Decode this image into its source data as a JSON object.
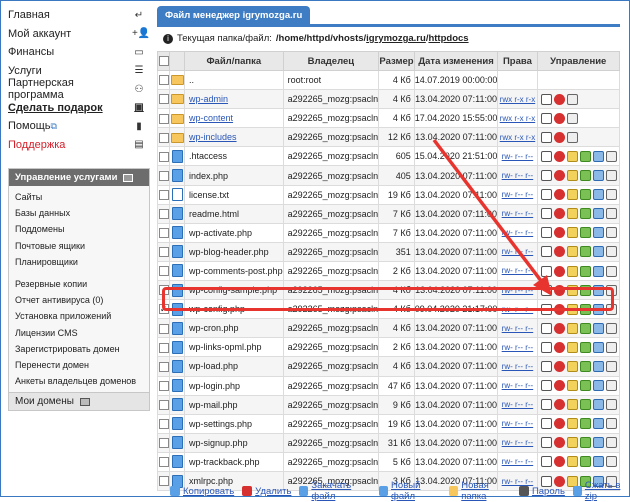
{
  "sidebar": {
    "items": [
      {
        "label": "Главная",
        "icon": "back-arrow-icon",
        "style": ""
      },
      {
        "label": "Мой аккаунт",
        "icon": "user-add-icon",
        "style": ""
      },
      {
        "label": "Финансы",
        "icon": "money-icon",
        "style": ""
      },
      {
        "label": "Услуги",
        "icon": "list-icon",
        "style": ""
      },
      {
        "label": "Партнерская программа",
        "icon": "partners-icon",
        "style": ""
      },
      {
        "label": "Сделать подарок",
        "icon": "gift-icon",
        "style": "bold"
      },
      {
        "label": "Помощь",
        "icon": "help-icon",
        "style": "",
        "ext": "⧉"
      },
      {
        "label": "Поддержка",
        "icon": "support-icon",
        "style": "red"
      }
    ],
    "services": {
      "title": "Управление услугами",
      "items": [
        "Сайты",
        "Базы данных",
        "Поддомены",
        "Почтовые ящики",
        "Планировщики"
      ],
      "items2": [
        "Резервные копии",
        "Отчет антивируса (0)",
        "Установка приложений",
        "Лицензии CMS",
        "Зарегистрировать домен",
        "Перенести домен",
        "Анкеты владельцев доменов"
      ],
      "footer": "Мои домены"
    }
  },
  "main": {
    "tab": "Файл менеджер igrymozga.ru",
    "path_label": "Текущая папка/файл:",
    "path_prefix": "/home/httpd/vhosts/",
    "path_domain": "igrymozga.ru",
    "path_sep": "/",
    "path_last": "httpdocs",
    "columns": [
      "Файл/папка",
      "Владелец",
      "Размер",
      "Дата изменения",
      "Права",
      "Управление"
    ]
  },
  "files": [
    {
      "name": "..",
      "owner": "root:root",
      "size": "4 Кб",
      "date": "14.07.2019 00:00:00",
      "perms": "",
      "type": "up",
      "link": false,
      "checked": false
    },
    {
      "name": "wp-admin",
      "owner": "a292265_mozg:psacln",
      "size": "4 Кб",
      "date": "13.04.2020 07:11:00",
      "perms": "rwx r-x r-x",
      "type": "folder",
      "link": true,
      "checked": false
    },
    {
      "name": "wp-content",
      "owner": "a292265_mozg:psacln",
      "size": "4 Кб",
      "date": "17.04.2020 15:55:00",
      "perms": "rwx r-x r-x",
      "type": "folder",
      "link": true,
      "checked": false
    },
    {
      "name": "wp-includes",
      "owner": "a292265_mozg:psacln",
      "size": "12 Кб",
      "date": "13.04.2020 07:11:00",
      "perms": "rwx r-x r-x",
      "type": "folder",
      "link": true,
      "checked": false
    },
    {
      "name": ".htaccess",
      "owner": "a292265_mozg:psacln",
      "size": "605",
      "date": "15.04.2020 21:51:00",
      "perms": "rw- r-- r--",
      "type": "file",
      "link": false,
      "checked": false
    },
    {
      "name": "index.php",
      "owner": "a292265_mozg:psacln",
      "size": "405",
      "date": "13.04.2020 07:11:00",
      "perms": "rw- r-- r--",
      "type": "file",
      "link": false,
      "checked": false
    },
    {
      "name": "license.txt",
      "owner": "a292265_mozg:psacln",
      "size": "19 Кб",
      "date": "13.04.2020 07:11:00",
      "perms": "rw- r-- r--",
      "type": "txt",
      "link": false,
      "checked": false
    },
    {
      "name": "readme.html",
      "owner": "a292265_mozg:psacln",
      "size": "7 Кб",
      "date": "13.04.2020 07:11:00",
      "perms": "rw- r-- r--",
      "type": "file",
      "link": false,
      "checked": false
    },
    {
      "name": "wp-activate.php",
      "owner": "a292265_mozg:psacln",
      "size": "7 Кб",
      "date": "13.04.2020 07:11:00",
      "perms": "rw- r-- r--",
      "type": "file",
      "link": false,
      "checked": false
    },
    {
      "name": "wp-blog-header.php",
      "owner": "a292265_mozg:psacln",
      "size": "351",
      "date": "13.04.2020 07:11:00",
      "perms": "rw- r-- r--",
      "type": "file",
      "link": false,
      "checked": false
    },
    {
      "name": "wp-comments-post.php",
      "owner": "a292265_mozg:psacln",
      "size": "2 Кб",
      "date": "13.04.2020 07:11:00",
      "perms": "rw- r-- r--",
      "type": "file",
      "link": false,
      "checked": false
    },
    {
      "name": "wp-config-sample.php",
      "owner": "a292265_mozg:psacln",
      "size": "4 Кб",
      "date": "13.04.2020 07:11:00",
      "perms": "rw- r-- r--",
      "type": "file",
      "link": false,
      "checked": false
    },
    {
      "name": "wp-config.php",
      "owner": "a292265_mozg:psacln",
      "size": "4 Кб",
      "date": "09.04.2020 21:17:00",
      "perms": "rw- r-- r--",
      "type": "file",
      "link": false,
      "checked": true
    },
    {
      "name": "wp-cron.php",
      "owner": "a292265_mozg:psacln",
      "size": "4 Кб",
      "date": "13.04.2020 07:11:00",
      "perms": "rw- r-- r--",
      "type": "file",
      "link": false,
      "checked": false
    },
    {
      "name": "wp-links-opml.php",
      "owner": "a292265_mozg:psacln",
      "size": "2 Кб",
      "date": "13.04.2020 07:11:00",
      "perms": "rw- r-- r--",
      "type": "file",
      "link": false,
      "checked": false
    },
    {
      "name": "wp-load.php",
      "owner": "a292265_mozg:psacln",
      "size": "4 Кб",
      "date": "13.04.2020 07:11:00",
      "perms": "rw- r-- r--",
      "type": "file",
      "link": false,
      "checked": false
    },
    {
      "name": "wp-login.php",
      "owner": "a292265_mozg:psacln",
      "size": "47 Кб",
      "date": "13.04.2020 07:11:00",
      "perms": "rw- r-- r--",
      "type": "file",
      "link": false,
      "checked": false
    },
    {
      "name": "wp-mail.php",
      "owner": "a292265_mozg:psacln",
      "size": "9 Кб",
      "date": "13.04.2020 07:11:00",
      "perms": "rw- r-- r--",
      "type": "file",
      "link": false,
      "checked": false
    },
    {
      "name": "wp-settings.php",
      "owner": "a292265_mozg:psacln",
      "size": "19 Кб",
      "date": "13.04.2020 07:11:00",
      "perms": "rw- r-- r--",
      "type": "file",
      "link": false,
      "checked": false
    },
    {
      "name": "wp-signup.php",
      "owner": "a292265_mozg:psacln",
      "size": "31 Кб",
      "date": "13.04.2020 07:11:00",
      "perms": "rw- r-- r--",
      "type": "file",
      "link": false,
      "checked": false
    },
    {
      "name": "wp-trackback.php",
      "owner": "a292265_mozg:psacln",
      "size": "5 Кб",
      "date": "13.04.2020 07:11:00",
      "perms": "rw- r-- r--",
      "type": "file",
      "link": false,
      "checked": false
    },
    {
      "name": "xmlrpc.php",
      "owner": "a292265_mozg:psacln",
      "size": "3 Кб",
      "date": "13.04.2020 07:11:00",
      "perms": "rw- r-- r--",
      "type": "file",
      "link": false,
      "checked": false
    }
  ],
  "actions": [
    {
      "label": "Копировать",
      "icon": "copy-icon",
      "color": "#5aa0e6"
    },
    {
      "label": "Удалить",
      "icon": "delete-icon",
      "color": "#d63030"
    },
    {
      "label": "Закачать файл",
      "icon": "upload-icon",
      "color": "#5aa0e6"
    },
    {
      "label": "Новый файл",
      "icon": "new-file-icon",
      "color": "#5aa0e6"
    },
    {
      "label": "Новая папка",
      "icon": "new-folder-icon",
      "color": "#f7c65c"
    },
    {
      "label": "Пароль",
      "icon": "key-icon",
      "color": "#555555"
    },
    {
      "label": "Сжать в zip",
      "icon": "zip-icon",
      "color": "#5aa0e6"
    }
  ],
  "colors": {
    "accent": "#3e7cc4",
    "highlight": "#e8342e",
    "link": "#2a56b7"
  }
}
